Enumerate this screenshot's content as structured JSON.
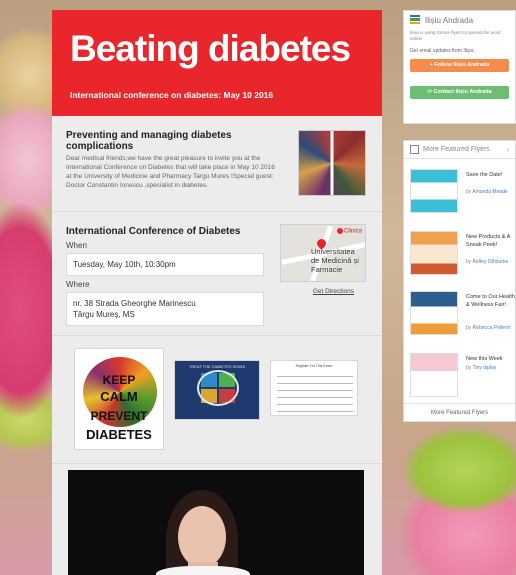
{
  "header": {
    "title": "Beating diabetes",
    "subtitle": "International conference on diabetes: May 10 2016",
    "bg_color": "#e8262b"
  },
  "intro": {
    "heading": "Preventing and managing diabetes complications",
    "body": "Dear medical friends,we have the great pleasure to invite you at the International Conference on Diabetes that will take place in May 10 2016 at the University of Medicine and Pharmacy Targu Mures !Special guest: Doctor Constantin Ionescu ,specialist in diabetes."
  },
  "event": {
    "heading": "International Conference of Diabetes",
    "when_label": "When",
    "when_value": "Tuesday, May 10th, 10:30pm",
    "where_label": "Where",
    "where_line1": "nr. 38 Strada Gheorghe Marinescu",
    "where_line2": "Târgu Mureș, MS",
    "map_place": "Clinica",
    "map_label": "Universitatea de Medicină și Farmacie",
    "directions_link": "Get Directions"
  },
  "images": {
    "keep_calm_1": "KEEP",
    "keep_calm_2": "CALM",
    "keep_calm_3": "PREVENT",
    "keep_calm_4": "DIABETES",
    "diagram_title": "TREAT THE DIABETES SIGNS",
    "form_title": "Register For This Event"
  },
  "sidebar": {
    "author_name": "Ilișiu Andrada",
    "author_note": "Ilisiu is using Smore flyers to spread the word online.",
    "email_label": "Get email updates from Ilișiu:",
    "follow_button": "Follow Ilișiu Andrada",
    "contact_button": "Contact Ilișiu Andrada",
    "more_heading": "More Featured Flyers",
    "more_footer": "More Featured Flyers",
    "items": [
      {
        "title": "Save the Date!",
        "by": "by",
        "author": "Amanda Meade"
      },
      {
        "title": "New Products & A Sneak Peek!",
        "by": "by",
        "author": "Kelley Othourke"
      },
      {
        "title": "Come to Our Health & Wellness Fair!",
        "by": "by",
        "author": "Rebecca Pellerin"
      },
      {
        "title": "New this Week",
        "by": "by",
        "author": "Tiny diplay"
      }
    ],
    "follow_color": "#f48c4d",
    "contact_color": "#6dbd73"
  }
}
